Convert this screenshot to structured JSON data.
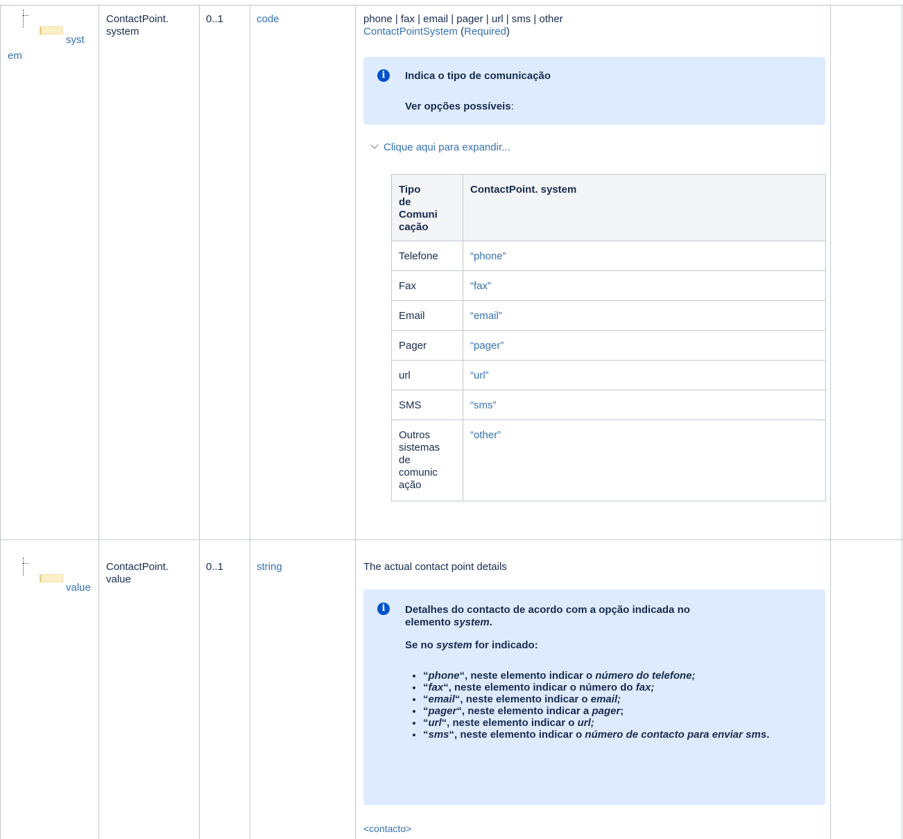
{
  "rows": [
    {
      "name_part1": "syst",
      "name_part2": "em",
      "path_line1": "ContactPoint.",
      "path_line2": "system",
      "card": "0..1",
      "type": "code",
      "summary": "phone | fax | email | pager | url | sms | other",
      "binding_valueset": "ContactPointSystem",
      "binding_open": " (",
      "binding_strength": "Required",
      "binding_close": ")",
      "info_title": "Indica o tipo de comunicação",
      "info_sub": "Ver opções possíveis",
      "info_sub_colon": ":",
      "expand_label": "Clique aqui para expandir...",
      "table": {
        "headers": [
          "Tipo de Comunicação",
          "ContactPoint. system"
        ],
        "header_col1_lines": [
          "Tipo",
          "de",
          "Comuni",
          "cação"
        ],
        "rows": [
          {
            "label": [
              "Telefone"
            ],
            "code": "“phone”"
          },
          {
            "label": [
              "Fax"
            ],
            "code": "“fax”"
          },
          {
            "label": [
              "Email"
            ],
            "code": "“email”"
          },
          {
            "label": [
              "Pager"
            ],
            "code": "“pager”"
          },
          {
            "label": [
              "url"
            ],
            "code": "“url”"
          },
          {
            "label": [
              "SMS"
            ],
            "code": "“sms”"
          },
          {
            "label": [
              "Outros",
              "sistemas",
              "de",
              "comunic",
              "ação"
            ],
            "code": "“other”"
          }
        ]
      }
    },
    {
      "name": "value",
      "path_line1": "ContactPoint.",
      "path_line2": "value",
      "card": "0..1",
      "type": "string",
      "summary": "The actual contact point details",
      "info_line1": "Detalhes do contacto de acordo com a opção indicada no",
      "info_line2_pre": "elemento ",
      "info_line2_em": "system",
      "info_line2_post": ".",
      "info_q_pre": "Se no ",
      "info_q_em": "system",
      "info_q_post": " for indicado:",
      "bullets": [
        {
          "open": "“",
          "key": "phone",
          "mid": "“, neste elemento indicar o ",
          "target": "número do telefone;",
          "end": ""
        },
        {
          "open": "“",
          "key": "fax",
          "mid": "“, neste elemento indicar o número do ",
          "target": "fax;",
          "end": ""
        },
        {
          "open": "“",
          "key": "email",
          "mid": "“, neste elemento indicar o ",
          "target": "email;",
          "end": ""
        },
        {
          "open": "“",
          "key": "pager",
          "mid": "“, neste elemento indicar a ",
          "target": "pager",
          "end": ";"
        },
        {
          "open": "“",
          "key": "url",
          "mid": "“, neste elemento indicar o ",
          "target": "url;",
          "end": ""
        },
        {
          "open": "“",
          "key": "sms",
          "mid": "“, neste elemento indicar o ",
          "target": "número de contacto para enviar sms",
          "end": "."
        }
      ],
      "example_link": "<contacto>"
    }
  ]
}
